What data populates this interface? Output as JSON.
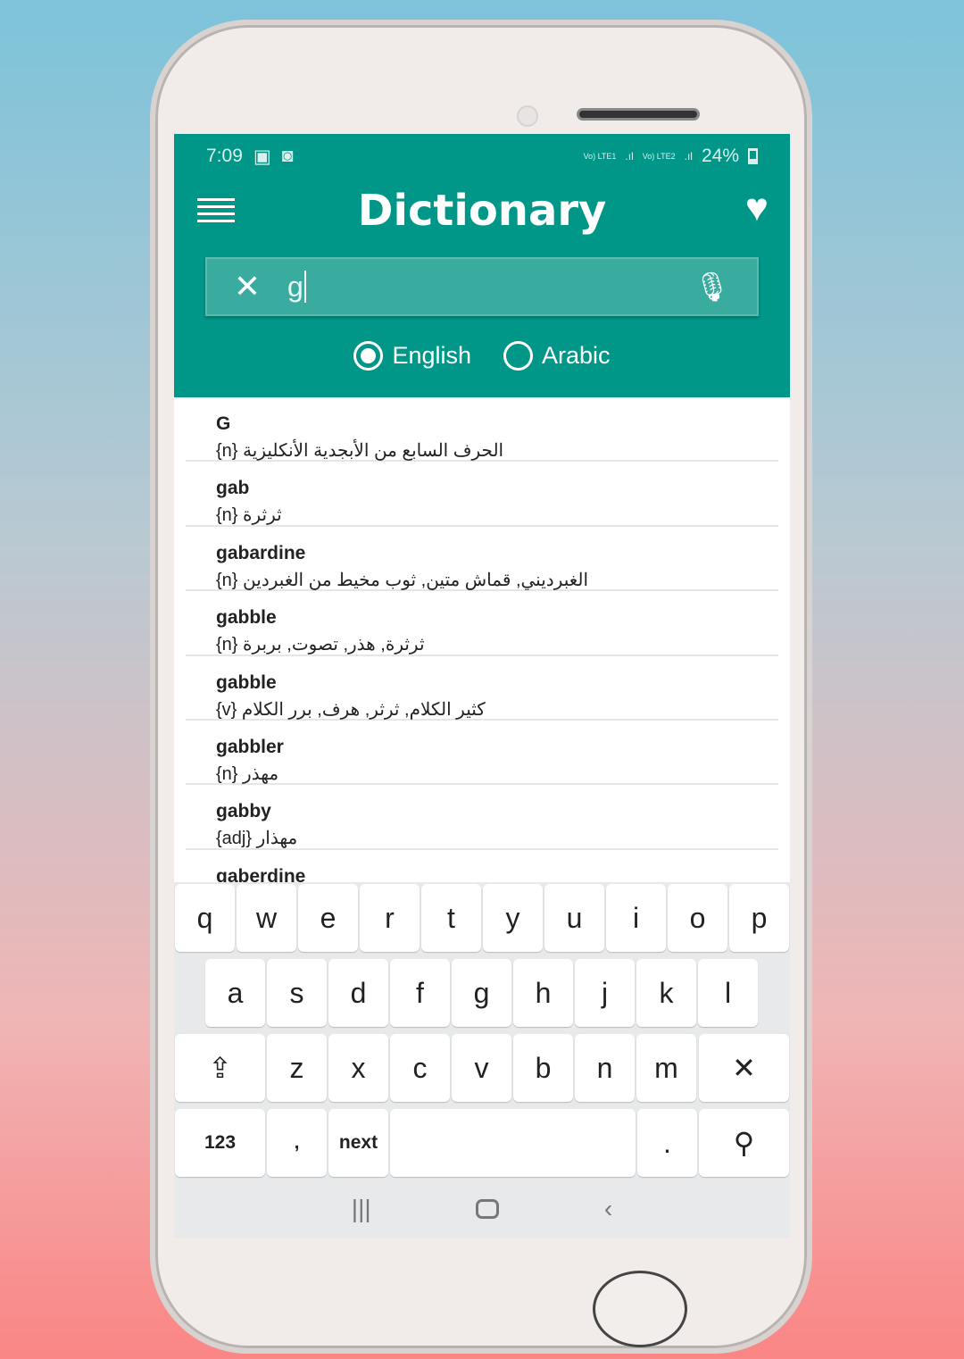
{
  "status": {
    "time": "7:09",
    "sim1": "Vo) LTE1",
    "sim2": "Vo) LTE2",
    "battery": "24%"
  },
  "header": {
    "title": "Dictionary",
    "menu_icon": "hamburger-icon",
    "favorite_icon": "heart-icon"
  },
  "search": {
    "value": "g",
    "clear_icon": "close-icon",
    "mic_icon": "microphone-icon"
  },
  "language": {
    "options": [
      {
        "label": "English",
        "selected": true
      },
      {
        "label": "Arabic",
        "selected": false
      }
    ]
  },
  "results": [
    {
      "word": "G",
      "pos": "{n}",
      "meaning": "الحرف السابع من الأبجدية الأنكليزية"
    },
    {
      "word": "gab",
      "pos": "{n}",
      "meaning": "ثرثرة"
    },
    {
      "word": "gabardine",
      "pos": "{n}",
      "meaning": "الغبرديني, قماش متين, ثوب مخيط من الغبردين"
    },
    {
      "word": "gabble",
      "pos": "{n}",
      "meaning": "ثرثرة, هذر, تصوت, بربرة"
    },
    {
      "word": "gabble",
      "pos": "{v}",
      "meaning": "كثير الكلام, ثرثر, هرف, برر الكلام"
    },
    {
      "word": "gabbler",
      "pos": "{n}",
      "meaning": "مهذر"
    },
    {
      "word": "gabby",
      "pos": "{adj}",
      "meaning": "مهذار"
    },
    {
      "word": "gaberdine",
      "pos": "",
      "meaning": ""
    }
  ],
  "keyboard": {
    "row1": [
      "q",
      "w",
      "e",
      "r",
      "t",
      "y",
      "u",
      "i",
      "o",
      "p"
    ],
    "row2": [
      "a",
      "s",
      "d",
      "f",
      "g",
      "h",
      "j",
      "k",
      "l"
    ],
    "row3": [
      "⇪",
      "z",
      "x",
      "c",
      "v",
      "b",
      "n",
      "m",
      "✕"
    ],
    "row4": {
      "numbers": "123",
      "comma": ",",
      "next": "next",
      "space": "",
      "period": ".",
      "search": "⚲"
    }
  }
}
